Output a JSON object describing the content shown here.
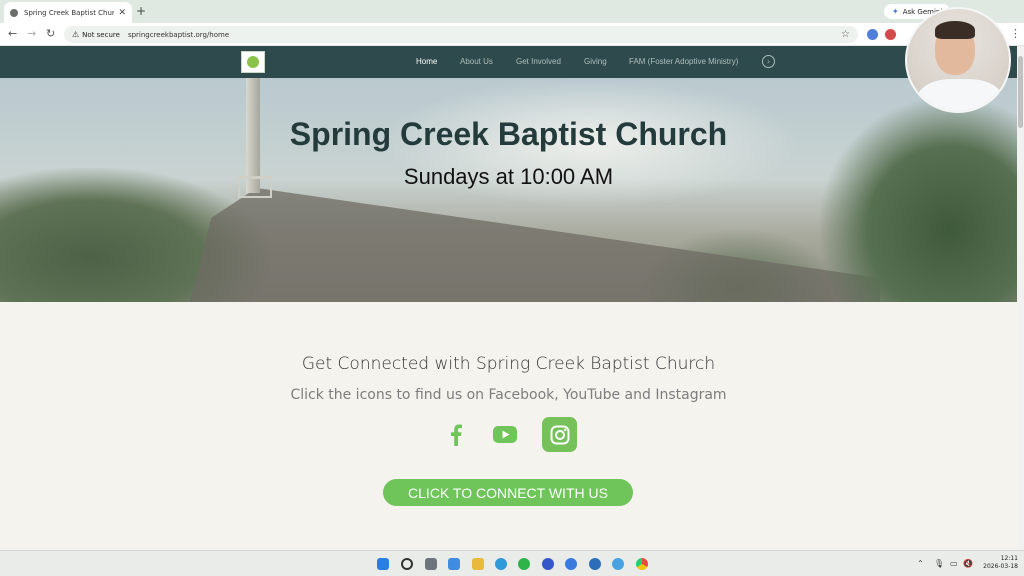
{
  "browser": {
    "tab_title": "Spring Creek Baptist Church | H",
    "tab_close": "✕",
    "new_tab": "+",
    "ask_gemini": "Ask Gemini",
    "security_label": "Not secure",
    "url": "springcreekbaptist.org/home",
    "icons": {
      "back": "arrow-left-icon",
      "forward": "arrow-right-icon",
      "reload": "reload-icon",
      "bookmark": "star-icon",
      "menu": "kebab-menu-icon"
    }
  },
  "site_nav": {
    "items": [
      {
        "label": "Home",
        "active": true
      },
      {
        "label": "About Us",
        "active": false
      },
      {
        "label": "Get Involved",
        "active": false
      },
      {
        "label": "Giving",
        "active": false
      },
      {
        "label": "FAM (Foster Adoptive Ministry)",
        "active": false
      }
    ],
    "more_glyph": "›"
  },
  "hero": {
    "title": "Spring Creek Baptist Church",
    "subtitle": "Sundays at 10:00 AM"
  },
  "connect": {
    "heading": "Get Connected with Spring Creek Baptist Church",
    "subheading": "Click the icons to find us on Facebook, YouTube and Instagram",
    "cta_label": "CLICK TO CONNECT WITH US"
  },
  "colors": {
    "nav_bg": "#2f4a4c",
    "accent_green": "#6fc55a",
    "title_color": "#243b3c"
  },
  "taskbar": {
    "time": "12:11",
    "date": "2026-03-18"
  }
}
